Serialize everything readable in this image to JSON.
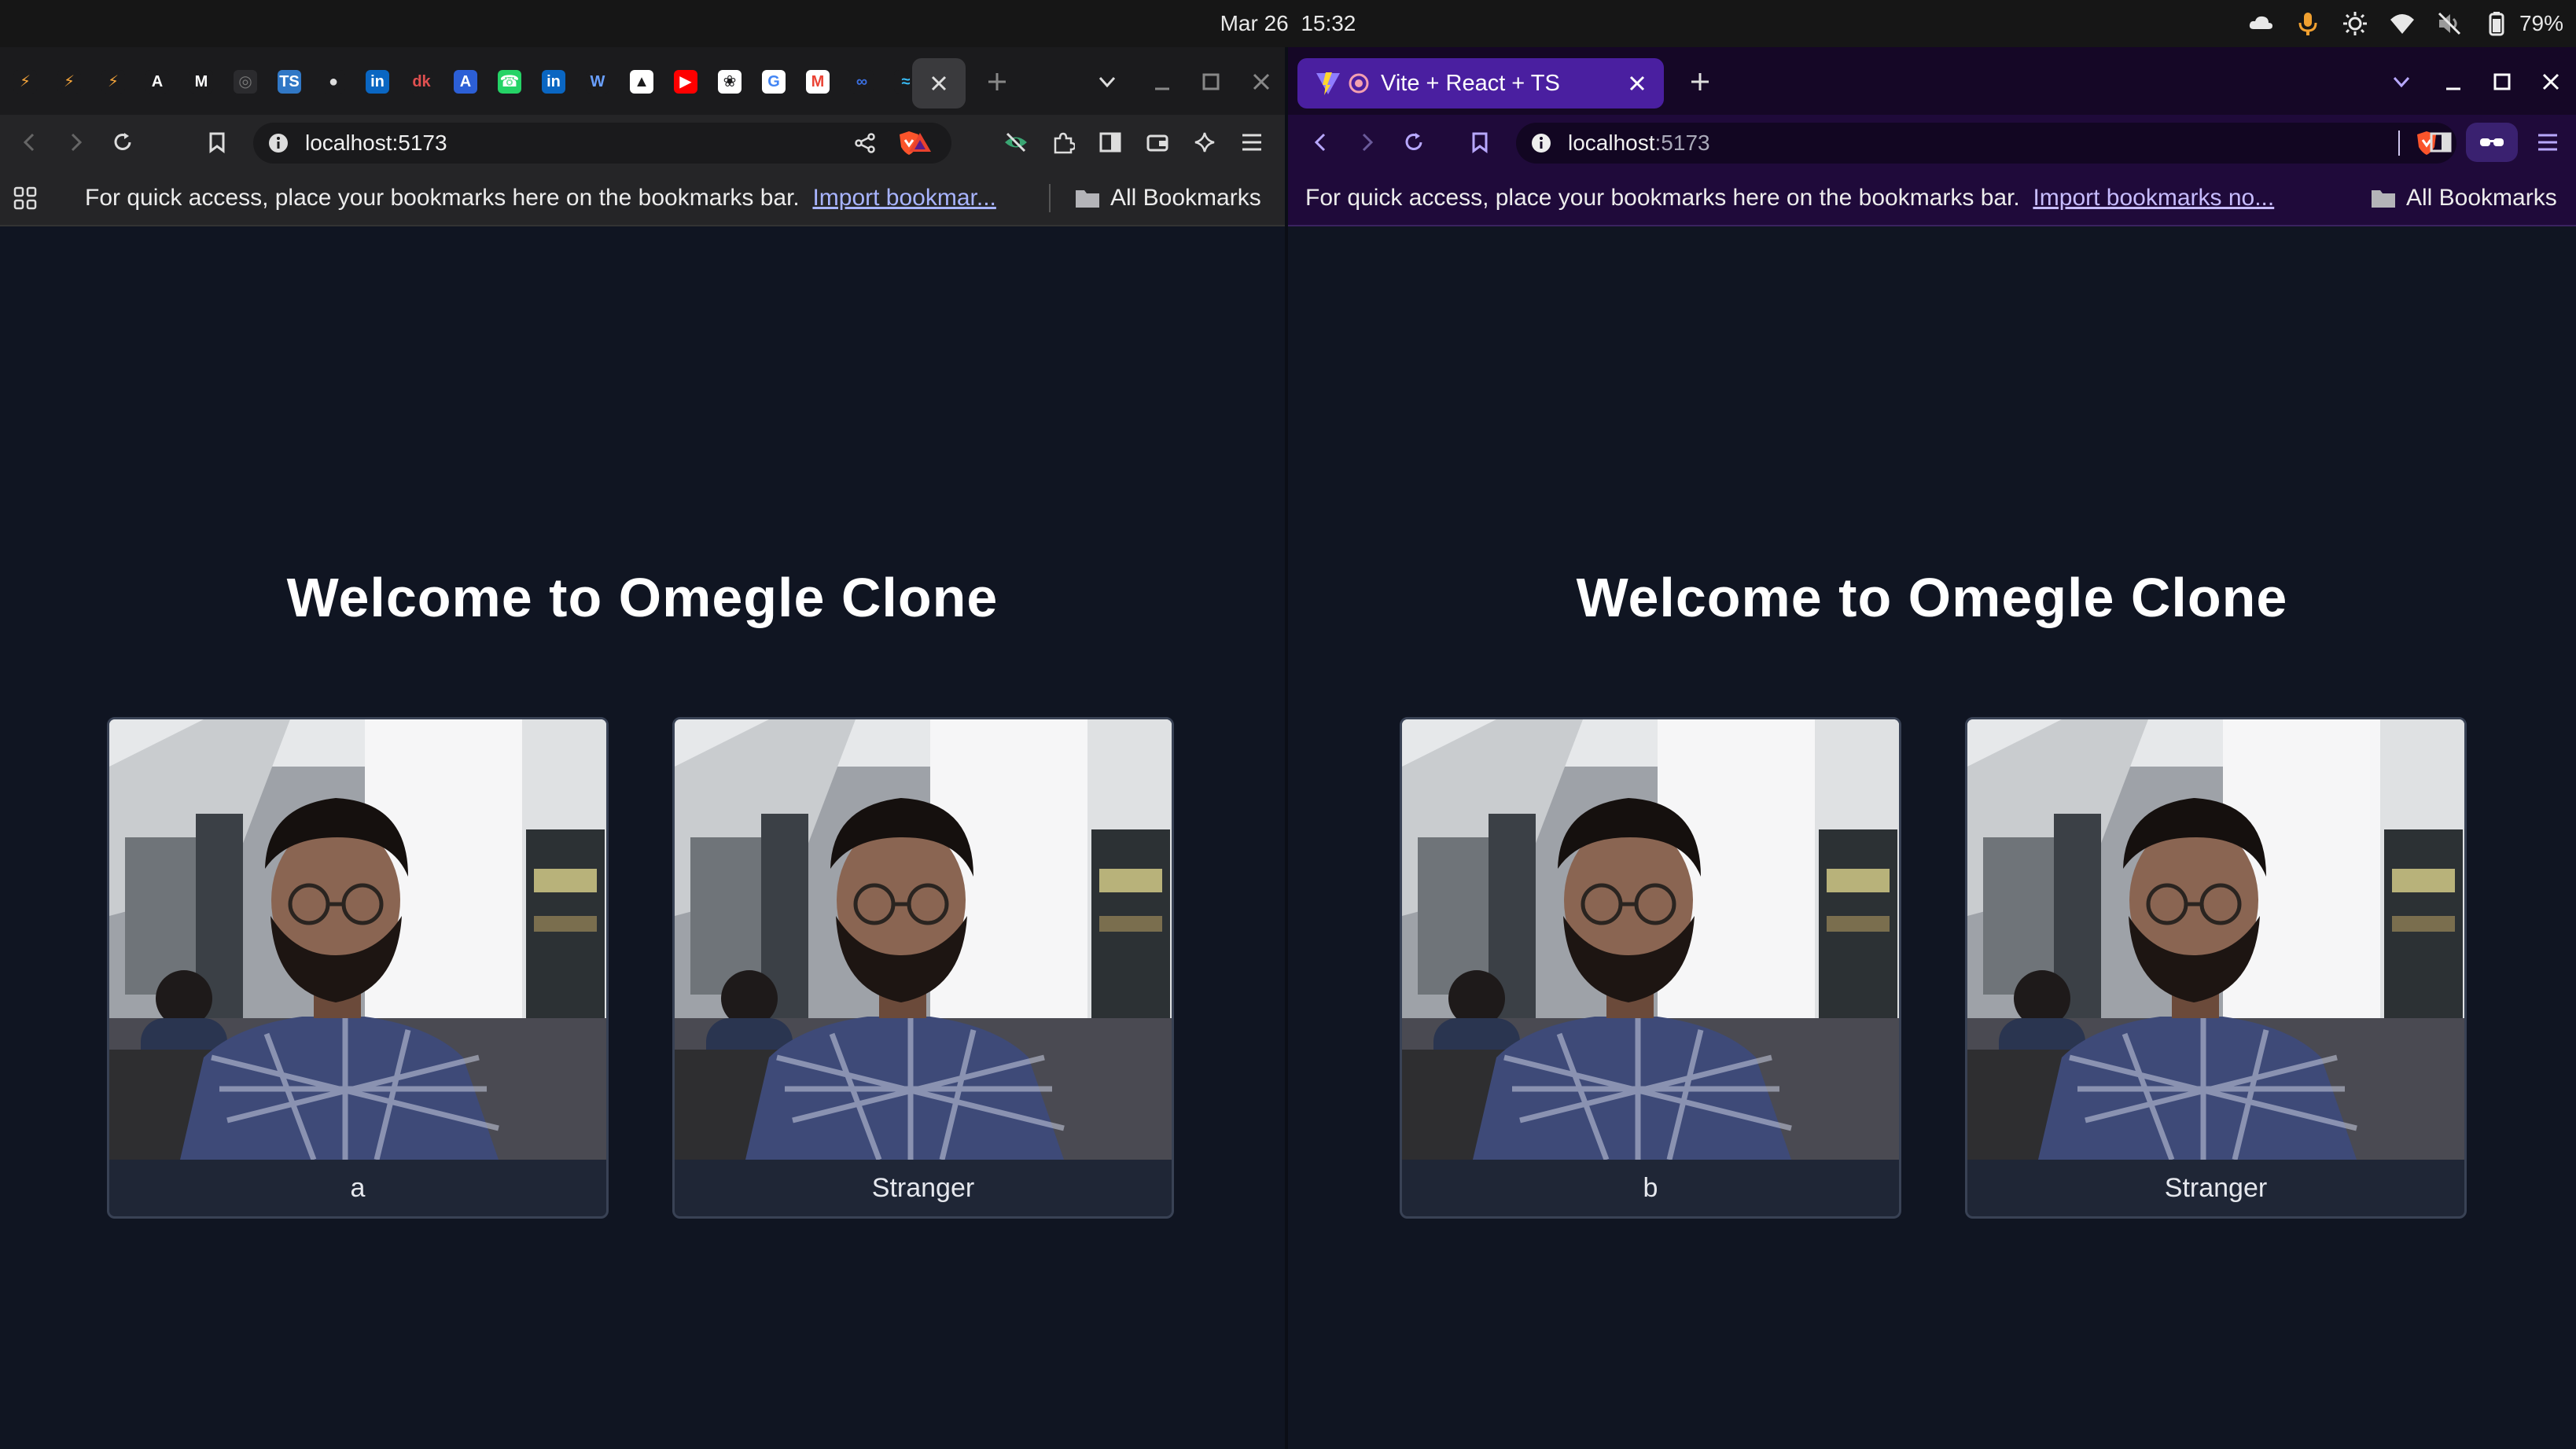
{
  "system": {
    "date": "Mar 26",
    "time": "15:32",
    "battery_percent": "79%",
    "tray_icons": [
      "cloud-icon",
      "microphone-icon",
      "brightness-icon",
      "wifi-icon",
      "volume-muted-icon",
      "battery-icon"
    ]
  },
  "left_window": {
    "pinned_tab_icons": [
      "zap-icon",
      "zap-icon",
      "zap-icon",
      "a-letter-icon",
      "m-letter-icon",
      "compass-icon",
      "typescript-icon",
      "globe-icon",
      "linkedin-icon",
      "dk-icon",
      "ai-icon",
      "whatsapp-icon",
      "linkedin-icon",
      "w-icon",
      "snapchat-icon",
      "youtube-icon",
      "openai-icon",
      "google-icon",
      "gmail-icon",
      "infinity-icon",
      "tailwind-icon"
    ],
    "url_host": "localhost:5173",
    "url_port": "",
    "bookmarks_message": "For quick access, place your bookmarks here on the bookmarks bar.",
    "import_link": "Import bookmar...",
    "all_bookmarks": "All Bookmarks",
    "heading": "Welcome to Omegle Clone",
    "videos": [
      {
        "label": "a"
      },
      {
        "label": "Stranger"
      }
    ]
  },
  "right_window": {
    "tab_title": "Vite + React + TS",
    "url_host": "localhost",
    "url_port": ":5173",
    "bookmarks_message": "For quick access, place your bookmarks here on the bookmarks bar.",
    "import_link": "Import bookmarks no...",
    "all_bookmarks": "All Bookmarks",
    "heading": "Welcome to Omegle Clone",
    "videos": [
      {
        "label": "b"
      },
      {
        "label": "Stranger"
      }
    ]
  },
  "colors": {
    "page_background": "#101522",
    "right_browser_accent": "#4a1fa0",
    "card_background": "#1f2636"
  }
}
